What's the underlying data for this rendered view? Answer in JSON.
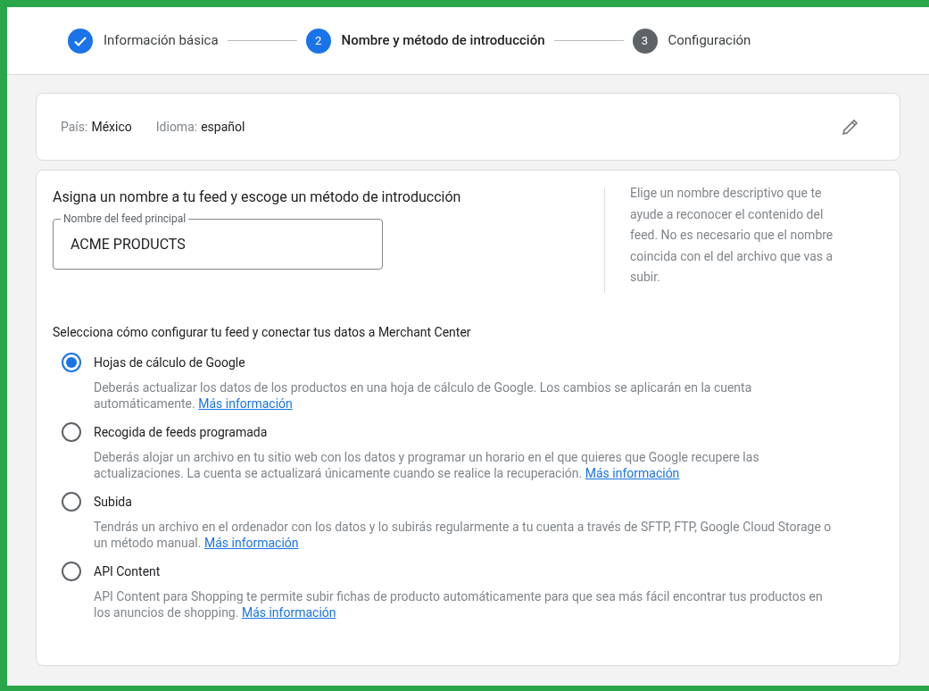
{
  "steps": [
    {
      "kind": "done",
      "label": "Información básica"
    },
    {
      "kind": "active",
      "number": "2",
      "label": "Nombre y método de introducción"
    },
    {
      "kind": "pending",
      "number": "3",
      "label": "Configuración"
    }
  ],
  "summary": {
    "country_label": "País:",
    "country": "México",
    "language_label": "Idioma:",
    "language": "español"
  },
  "feed": {
    "heading": "Asigna un nombre a tu feed y escoge un método de introducción",
    "field_label": "Nombre del feed principal",
    "value": "ACME PRODUCTS",
    "help": "Elige un nombre descriptivo que te ayude a reconocer el contenido del feed. No es necesario que el nombre coincida con el del archivo que vas a subir."
  },
  "methods_heading": "Selecciona cómo configurar tu feed y conectar tus datos a Merchant Center",
  "methods": [
    {
      "label": "Hojas de cálculo de Google",
      "selected": true,
      "description": "Deberás actualizar los datos de los productos en una hoja de cálculo de Google. Los cambios se aplicarán en la cuenta automáticamente.",
      "link": "Más información"
    },
    {
      "label": "Recogida de feeds programada",
      "selected": false,
      "description": "Deberás alojar un archivo en tu sitio web con los datos y programar un horario en el que quieres que Google recupere las actualizaciones. La cuenta se actualizará únicamente cuando se realice la recuperación.",
      "link": "Más información"
    },
    {
      "label": "Subida",
      "selected": false,
      "description": "Tendrás un archivo en el ordenador con los datos y lo subirás regularmente a tu cuenta a través de SFTP, FTP, Google Cloud Storage o un método manual.",
      "link": "Más información"
    },
    {
      "label": "API Content",
      "selected": false,
      "description": "API Content para Shopping te permite subir fichas de producto automáticamente para que sea más fácil encontrar tus productos en los anuncios de shopping.",
      "link": "Más información"
    }
  ]
}
